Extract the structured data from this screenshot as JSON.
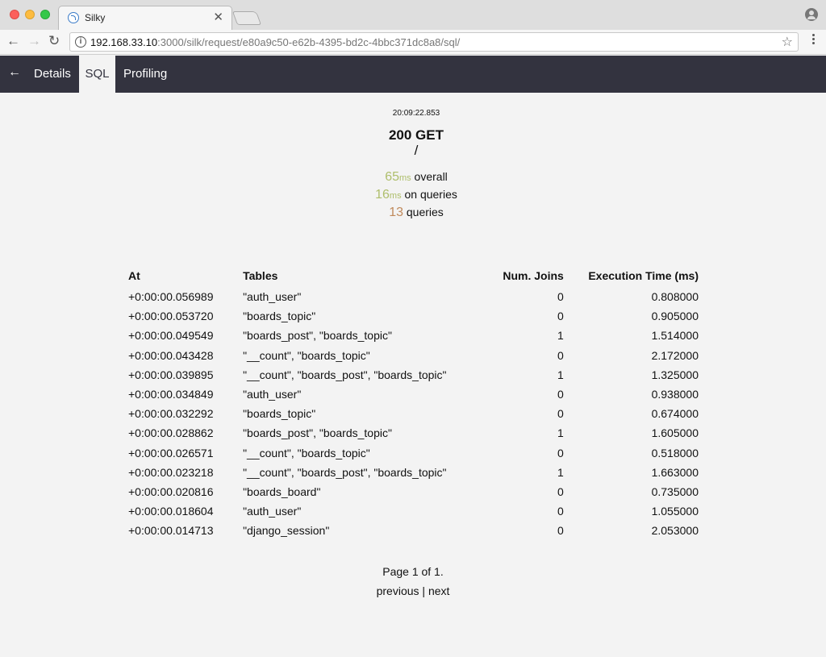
{
  "browser": {
    "tab_title": "Silky",
    "url_host": "192.168.33.10",
    "url_rest": ":3000/silk/request/e80a9c50-e62b-4395-bd2c-4bbc371dc8a8/sql/"
  },
  "nav": {
    "back_icon": "arrow-left-icon",
    "items": [
      {
        "label": "Details",
        "active": false
      },
      {
        "label": "SQL",
        "active": true
      },
      {
        "label": "Profiling",
        "active": false
      }
    ]
  },
  "summary": {
    "timestamp": "20:09:22.853",
    "status": "200 GET",
    "path": "/",
    "overall_value": "65",
    "overall_unit": "ms",
    "overall_label": " overall",
    "queries_time_value": "16",
    "queries_time_unit": "ms",
    "queries_time_label": " on queries",
    "query_count": "13",
    "query_count_label": " queries"
  },
  "table": {
    "headers": [
      "At",
      "Tables",
      "Num. Joins",
      "Execution Time (ms)"
    ],
    "rows": [
      [
        "+0:00:00.056989",
        "\"auth_user\"",
        "0",
        "0.808000"
      ],
      [
        "+0:00:00.053720",
        "\"boards_topic\"",
        "0",
        "0.905000"
      ],
      [
        "+0:00:00.049549",
        "\"boards_post\", \"boards_topic\"",
        "1",
        "1.514000"
      ],
      [
        "+0:00:00.043428",
        "\"__count\", \"boards_topic\"",
        "0",
        "2.172000"
      ],
      [
        "+0:00:00.039895",
        "\"__count\", \"boards_post\", \"boards_topic\"",
        "1",
        "1.325000"
      ],
      [
        "+0:00:00.034849",
        "\"auth_user\"",
        "0",
        "0.938000"
      ],
      [
        "+0:00:00.032292",
        "\"boards_topic\"",
        "0",
        "0.674000"
      ],
      [
        "+0:00:00.028862",
        "\"boards_post\", \"boards_topic\"",
        "1",
        "1.605000"
      ],
      [
        "+0:00:00.026571",
        "\"__count\", \"boards_topic\"",
        "0",
        "0.518000"
      ],
      [
        "+0:00:00.023218",
        "\"__count\", \"boards_post\", \"boards_topic\"",
        "1",
        "1.663000"
      ],
      [
        "+0:00:00.020816",
        "\"boards_board\"",
        "0",
        "0.735000"
      ],
      [
        "+0:00:00.018604",
        "\"auth_user\"",
        "0",
        "1.055000"
      ],
      [
        "+0:00:00.014713",
        "\"django_session\"",
        "0",
        "2.053000"
      ]
    ]
  },
  "pager": {
    "page_text": "Page 1 of 1.",
    "previous": "previous",
    "separator": "|",
    "next": "next"
  }
}
